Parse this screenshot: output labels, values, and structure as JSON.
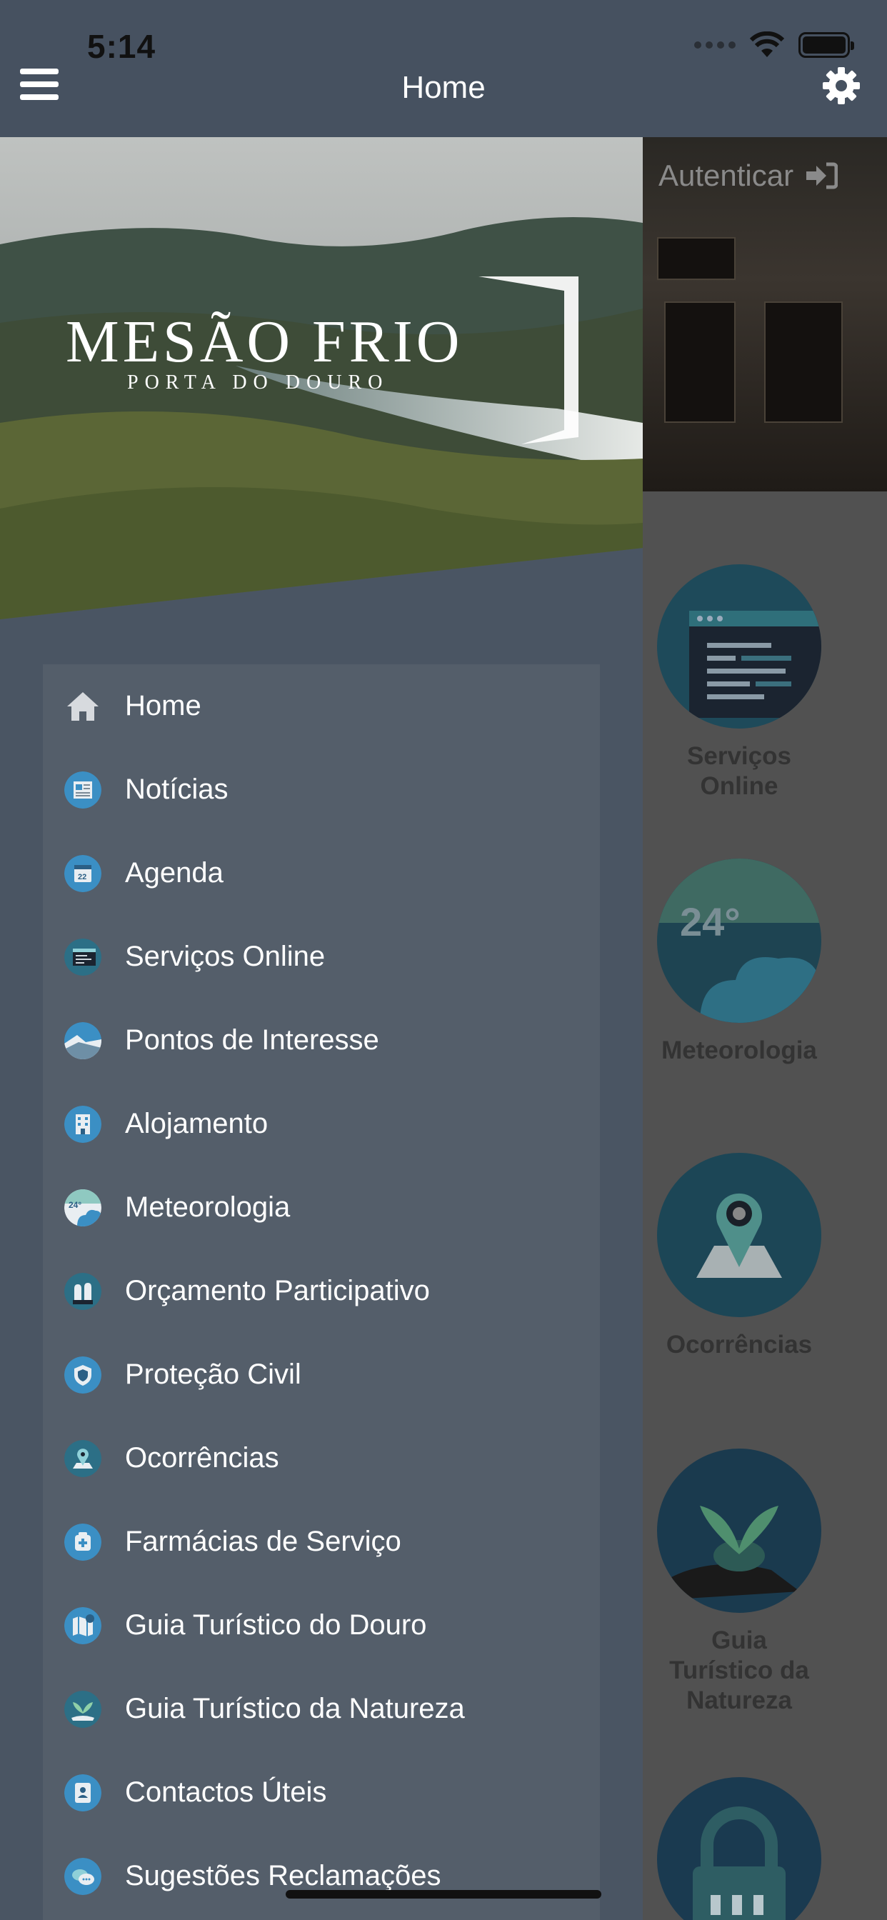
{
  "status_bar": {
    "time": "5:14"
  },
  "header": {
    "title": "Home"
  },
  "background": {
    "auth_label": "Autenticar",
    "tiles": [
      {
        "label": "Serviços Online"
      },
      {
        "label": "Meteorologia",
        "icon_text": "24°"
      },
      {
        "label": "Ocorrências"
      },
      {
        "label": "Guia Turístico da Natureza"
      },
      {
        "label": ""
      }
    ]
  },
  "drawer": {
    "brand": {
      "title": "MESÃO FRIO",
      "subtitle": "PORTA DO DOURO"
    },
    "items": [
      {
        "label": "Home",
        "icon": "home-icon"
      },
      {
        "label": "Notícias",
        "icon": "news-icon"
      },
      {
        "label": "Agenda",
        "icon": "calendar-icon"
      },
      {
        "label": "Serviços Online",
        "icon": "online-services-icon"
      },
      {
        "label": "Pontos de Interesse",
        "icon": "points-of-interest-icon"
      },
      {
        "label": "Alojamento",
        "icon": "accommodation-icon"
      },
      {
        "label": "Meteorologia",
        "icon": "weather-icon"
      },
      {
        "label": "Orçamento Participativo",
        "icon": "participatory-budget-icon"
      },
      {
        "label": "Proteção Civil",
        "icon": "civil-protection-icon"
      },
      {
        "label": "Ocorrências",
        "icon": "occurrences-icon"
      },
      {
        "label": "Farmácias de Serviço",
        "icon": "pharmacy-icon"
      },
      {
        "label": "Guia Turístico do Douro",
        "icon": "douro-guide-icon"
      },
      {
        "label": "Guia Turístico da Natureza",
        "icon": "nature-guide-icon"
      },
      {
        "label": "Contactos Úteis",
        "icon": "contacts-icon"
      },
      {
        "label": "Sugestões Reclamações",
        "icon": "suggestions-icon"
      }
    ]
  },
  "colors": {
    "topbar": "#465160",
    "drawer": "#4a5563",
    "menu_panel": "#545e6a",
    "icon_blue": "#3b8fc4",
    "text": "#ffffff"
  }
}
